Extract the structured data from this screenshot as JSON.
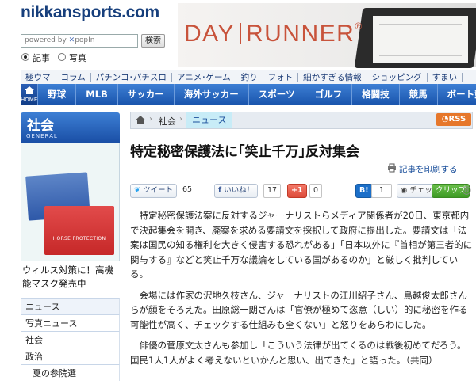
{
  "header": {
    "logo": "nikkansports.com",
    "search_placeholder": "powered by",
    "search_brand": "popIn",
    "search_button": "検索",
    "radio_article": "記事",
    "radio_photo": "写真"
  },
  "ad": {
    "brand_left": "DAY",
    "brand_right": "RUNNER",
    "mark": "®"
  },
  "subnav": [
    "極ウマ",
    "コラム",
    "パチンコ･パチスロ",
    "アニメ･ゲーム",
    "釣り",
    "フォト",
    "細かすぎる情報",
    "ショッピング",
    "すまい"
  ],
  "mainnav": {
    "home": "HOME",
    "items": [
      "野球",
      "MLB",
      "サッカー",
      "海外サッカー",
      "スポーツ",
      "ゴルフ",
      "格闘技",
      "競馬",
      "ボート競"
    ]
  },
  "sidebar": {
    "title": "社会",
    "subtitle": "GENERAL",
    "promo_label": "HORSE PROTECTION",
    "promo_text": "ウィルス対策に！高機能マスク発売中",
    "items": [
      {
        "label": "ニュース",
        "active": true
      },
      {
        "label": "写真ニュース"
      },
      {
        "label": "社会"
      },
      {
        "label": "政治"
      },
      {
        "label": "夏の参院選",
        "indent": true
      }
    ]
  },
  "breadcrumb": {
    "section": "社会",
    "current": "ニュース",
    "rss": "RSS"
  },
  "article": {
    "headline": "特定秘密保護法に｢笑止千万｣反対集会",
    "print_label": "記事を印刷する",
    "share": {
      "tweet": "ツイート",
      "tweet_count": "65",
      "like": "いいね！",
      "like_count": "17",
      "gplus": "+1",
      "gplus_count": "0",
      "hatena": "B!",
      "hatena_count": "1",
      "check": "チェック",
      "clip": "クリップ"
    },
    "paragraphs": [
      "特定秘密保護法案に反対するジャーナリストらメディア関係者が20日、東京都内で決起集会を開き、廃案を求める要請文を採択して政府に提出した。要請文は「法案は国民の知る権利を大きく侵害する恐れがある」「日本以外に『首相が第三者的に関与する』などと笑止千万な議論をしている国があるのか」と厳しく批判している。",
      "会場には作家の沢地久枝さん、ジャーナリストの江川紹子さん、鳥越俊太郎さんらが顔をそろえた。田原総一朗さんは「官僚が極めて恣意（しい）的に秘密を作る可能性が高く、チェックする仕組みも全くない」と怒りをあらわにした。",
      "俳優の菅原文太さんも参加し「こういう法律が出てくるのは戦後初めてだろう。国民1人1人がよく考えないといかんと思い、出てきた」と語った。（共同）"
    ]
  },
  "colors": {
    "nav_blue": "#1a55ad",
    "rss_orange": "#e6772b",
    "link_blue": "#1a4f9b"
  }
}
